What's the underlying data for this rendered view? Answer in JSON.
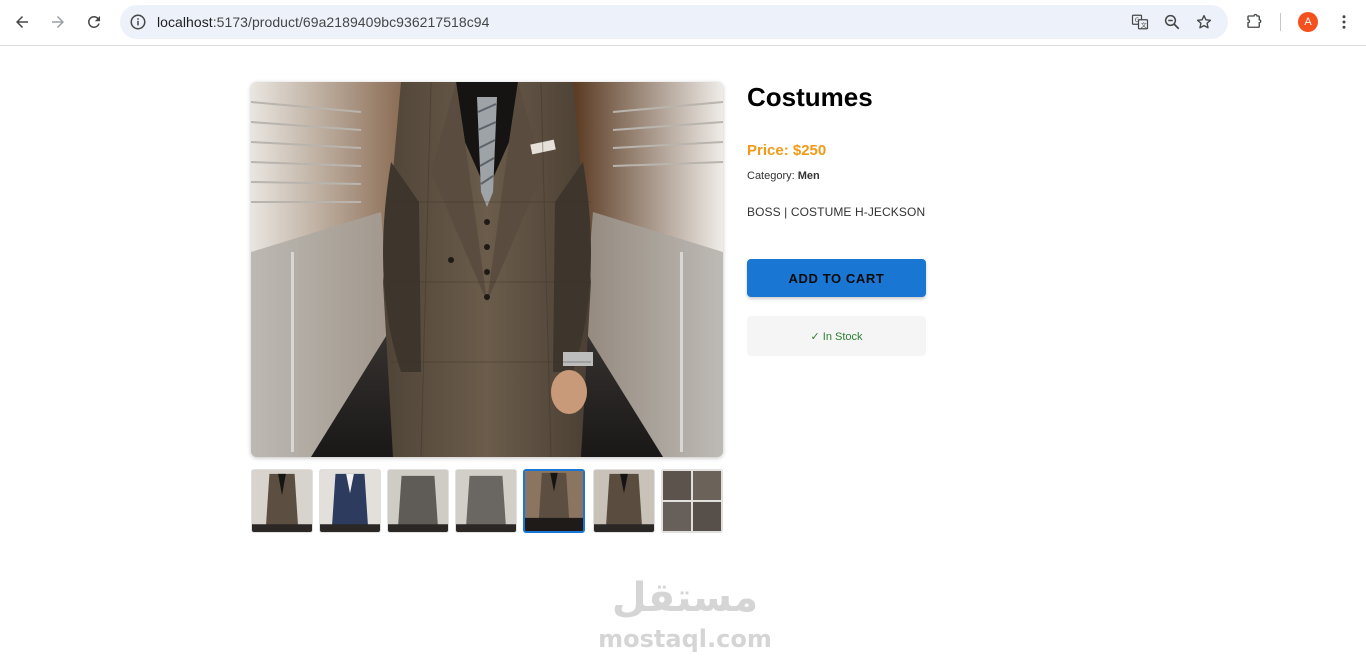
{
  "browser": {
    "url_host": "localhost",
    "url_path": ":5173/product/69a2189409bc936217518c94",
    "avatar_letter": "A",
    "avatar_color": "#f4511e"
  },
  "product": {
    "title": "Costumes",
    "price": "Price: $250",
    "category_label": "Category:",
    "category_value": "Men",
    "description": "BOSS | COSTUME H-JECKSON",
    "add_to_cart_label": "ADD TO CART",
    "stock_label": "✓ In Stock",
    "thumbnail_count": 7,
    "selected_thumbnail": 5
  },
  "colors": {
    "accent": "#1976d2",
    "price": "#f09a16",
    "stock_text": "#2e7d32"
  },
  "watermark": {
    "arabic": "مستقل",
    "latin": "mostaql.com"
  }
}
